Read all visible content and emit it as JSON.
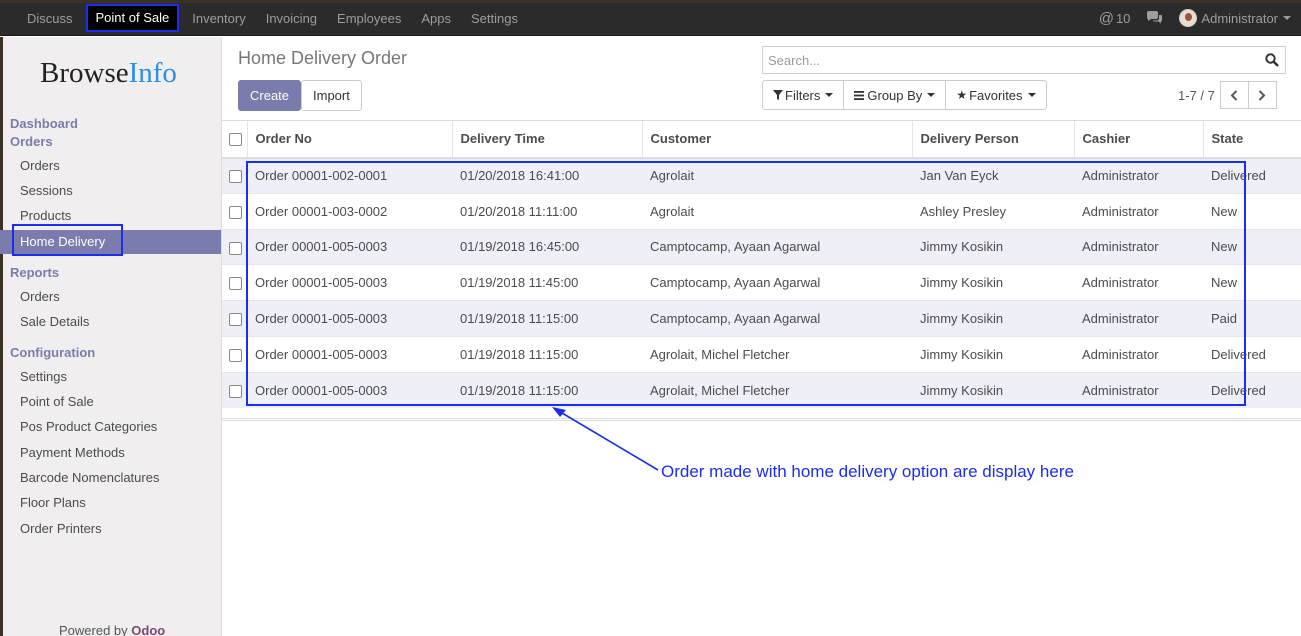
{
  "topnav": {
    "items": [
      "Discuss",
      "Point of Sale",
      "Inventory",
      "Invoicing",
      "Employees",
      "Apps",
      "Settings"
    ],
    "active": "Point of Sale",
    "mentions_count": "10",
    "user": "Administrator"
  },
  "sidebar": {
    "logo_part1": "Browse",
    "logo_part2": "Info",
    "dashboard": "Dashboard",
    "orders_section": "Orders",
    "orders_items": [
      "Orders",
      "Sessions",
      "Products",
      "Home Delivery"
    ],
    "active_item": "Home Delivery",
    "reports_section": "Reports",
    "reports_items": [
      "Orders",
      "Sale Details"
    ],
    "config_section": "Configuration",
    "config_items": [
      "Settings",
      "Point of Sale",
      "Pos Product Categories",
      "Payment Methods",
      "Barcode Nomenclatures",
      "Floor Plans",
      "Order Printers"
    ],
    "powered_by": "Powered by",
    "powered_brand": "Odoo"
  },
  "page": {
    "title": "Home Delivery Order",
    "create_label": "Create",
    "import_label": "Import"
  },
  "search": {
    "placeholder": "Search...",
    "filters_label": "Filters",
    "groupby_label": "Group By",
    "favorites_label": "Favorites"
  },
  "pager": {
    "value": "1-7 / 7"
  },
  "table": {
    "columns": [
      "Order No",
      "Delivery Time",
      "Customer",
      "Delivery Person",
      "Cashier",
      "State"
    ],
    "rows": [
      [
        "Order 00001-002-0001",
        "01/20/2018 16:41:00",
        "Agrolait",
        "Jan Van Eyck",
        "Administrator",
        "Delivered"
      ],
      [
        "Order 00001-003-0002",
        "01/20/2018 11:11:00",
        "Agrolait",
        "Ashley Presley",
        "Administrator",
        "New"
      ],
      [
        "Order 00001-005-0003",
        "01/19/2018 16:45:00",
        "Camptocamp, Ayaan Agarwal",
        "Jimmy Kosikin",
        "Administrator",
        "New"
      ],
      [
        "Order 00001-005-0003",
        "01/19/2018 11:45:00",
        "Camptocamp, Ayaan Agarwal",
        "Jimmy Kosikin",
        "Administrator",
        "New"
      ],
      [
        "Order 00001-005-0003",
        "01/19/2018 11:15:00",
        "Camptocamp, Ayaan Agarwal",
        "Jimmy Kosikin",
        "Administrator",
        "Paid"
      ],
      [
        "Order 00001-005-0003",
        "01/19/2018 11:15:00",
        "Agrolait, Michel Fletcher",
        "Jimmy Kosikin",
        "Administrator",
        "Delivered"
      ],
      [
        "Order 00001-005-0003",
        "01/19/2018 11:15:00",
        "Agrolait, Michel Fletcher",
        "Jimmy Kosikin",
        "Administrator",
        "Delivered"
      ]
    ]
  },
  "annotation": {
    "text": "Order made with home delivery option are display here",
    "color": "#1b2ef0"
  },
  "colors": {
    "brand": "#7c7bad",
    "navbar": "#2b2b2b",
    "odoo": "#7c4a73"
  }
}
